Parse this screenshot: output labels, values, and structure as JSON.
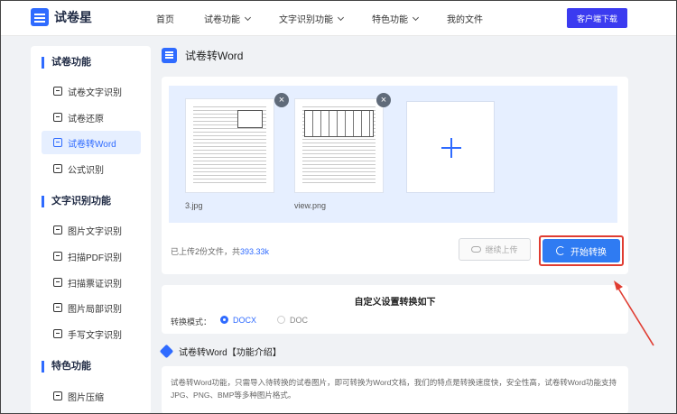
{
  "header": {
    "logo_text": "试卷星",
    "nav": [
      {
        "label": "首页",
        "has_dropdown": false
      },
      {
        "label": "试卷功能",
        "has_dropdown": true
      },
      {
        "label": "文字识别功能",
        "has_dropdown": true
      },
      {
        "label": "特色功能",
        "has_dropdown": true
      },
      {
        "label": "我的文件",
        "has_dropdown": false
      }
    ],
    "download_label": "客户端下载"
  },
  "sidebar": {
    "groups": [
      {
        "title": "试卷功能",
        "items": [
          {
            "label": "试卷文字识别",
            "active": false
          },
          {
            "label": "试卷还原",
            "active": false
          },
          {
            "label": "试卷转Word",
            "active": true
          },
          {
            "label": "公式识别",
            "active": false
          }
        ]
      },
      {
        "title": "文字识别功能",
        "items": [
          {
            "label": "图片文字识别",
            "active": false
          },
          {
            "label": "扫描PDF识别",
            "active": false
          },
          {
            "label": "扫描票证识别",
            "active": false
          },
          {
            "label": "图片局部识别",
            "active": false
          },
          {
            "label": "手写文字识别",
            "active": false
          }
        ]
      },
      {
        "title": "特色功能",
        "items": [
          {
            "label": "图片压缩",
            "active": false
          }
        ]
      }
    ]
  },
  "main": {
    "page_title": "试卷转Word",
    "files": [
      {
        "name": "3.jpg"
      },
      {
        "name": "view.png"
      }
    ],
    "close_glyph": "×",
    "upload_info_prefix": "已上传2份文件，共",
    "upload_info_size": "393.33k",
    "continue_label": "继续上传",
    "start_label": "开始转换",
    "settings": {
      "title": "自定义设置转换如下",
      "mode_label": "转换模式：",
      "options": [
        {
          "label": "DOCX",
          "selected": true
        },
        {
          "label": "DOC",
          "selected": false
        }
      ]
    },
    "intro": {
      "title": "试卷转Word【功能介绍】",
      "text": "试卷转Word功能，只需导入待转换的试卷图片，即可转换为Word文档，我们的特点是转换速度快，安全性高，试卷转Word功能支持JPG、PNG、BMP等多种图片格式。"
    }
  },
  "colors": {
    "accent": "#2f6bff",
    "download_button": "#3b3bf0",
    "highlight_outline": "#e03c31",
    "annotation_arrow": "#e03c31"
  }
}
